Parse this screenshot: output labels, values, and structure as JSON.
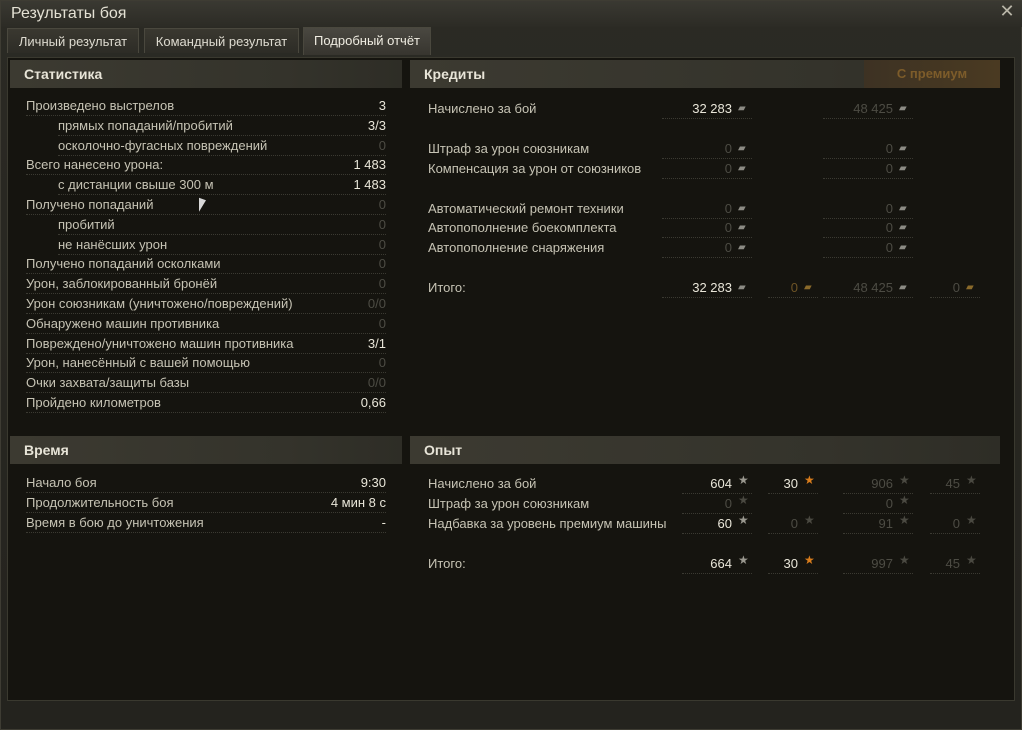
{
  "window": {
    "title": "Результаты боя",
    "close_icon": "close-icon"
  },
  "tabs": [
    {
      "label": "Личный результат"
    },
    {
      "label": "Командный результат"
    },
    {
      "label": "Подробный отчёт",
      "active": true
    }
  ],
  "statistics": {
    "header": "Статистика",
    "rows": [
      {
        "label": "Произведено выстрелов",
        "value": "3"
      },
      {
        "label": "прямых попаданий/пробитий",
        "value": "3/3"
      },
      {
        "label": "осколочно-фугасных повреждений",
        "value": "0"
      },
      {
        "label": "Всего нанесено урона:",
        "value": "1 483"
      },
      {
        "label": "с дистанции свыше 300 м",
        "value": "1 483"
      },
      {
        "label": "Получено попаданий",
        "value": "0"
      },
      {
        "label": "пробитий",
        "value": "0"
      },
      {
        "label": "не нанёсших урон",
        "value": "0"
      },
      {
        "label": "Получено попаданий осколками",
        "value": "0"
      },
      {
        "label": "Урон, заблокированный бронёй",
        "value": "0"
      },
      {
        "label": "Урон союзникам (уничтожено/повреждений)",
        "value": "0/0"
      },
      {
        "label": "Обнаружено машин противника",
        "value": "0"
      },
      {
        "label": "Повреждено/уничтожено машин противника",
        "value": "3/1"
      },
      {
        "label": "Урон, нанесённый с вашей помощью",
        "value": "0"
      },
      {
        "label": "Очки захвата/защиты базы",
        "value": "0/0"
      },
      {
        "label": "Пройдено километров",
        "value": "0,66"
      }
    ]
  },
  "time": {
    "header": "Время",
    "rows": [
      {
        "label": "Начало боя",
        "value": "9:30"
      },
      {
        "label": "Продолжительность боя",
        "value": "4 мин 8 с"
      },
      {
        "label": "Время в бою до уничтожения",
        "value": "-"
      }
    ]
  },
  "credits": {
    "header": "Кредиты",
    "premium_header": "С премиум",
    "rows": [
      {
        "label": "Начислено за бой",
        "credits": "32 283",
        "premium": "48 425"
      },
      {
        "label": "Штраф за урон союзникам",
        "credits": "0",
        "premium": "0"
      },
      {
        "label": "Компенсация за урон от союзников",
        "credits": "0",
        "premium": "0"
      },
      {
        "label": "Автоматический ремонт техники",
        "credits": "0",
        "premium": "0"
      },
      {
        "label": "Автопополнение боекомплекта",
        "credits": "0",
        "premium": "0"
      },
      {
        "label": "Автопополнение снаряжения",
        "credits": "0",
        "premium": "0"
      },
      {
        "label": "Итого:",
        "credits": "32 283",
        "gold": "0",
        "premium": "48 425",
        "premium_gold": "0"
      }
    ]
  },
  "experience": {
    "header": "Опыт",
    "rows": [
      {
        "label": "Начислено за бой",
        "xp": "604",
        "free_xp": "30",
        "premium_xp": "906",
        "premium_free_xp": "45"
      },
      {
        "label": "Штраф за урон союзникам",
        "xp": "0",
        "premium_xp": "0"
      },
      {
        "label": "Надбавка за уровень премиум машины",
        "xp": "60",
        "free_xp": "0",
        "premium_xp": "91",
        "premium_free_xp": "0"
      },
      {
        "label": "Итого:",
        "xp": "664",
        "free_xp": "30",
        "premium_xp": "997",
        "premium_free_xp": "45"
      }
    ]
  }
}
